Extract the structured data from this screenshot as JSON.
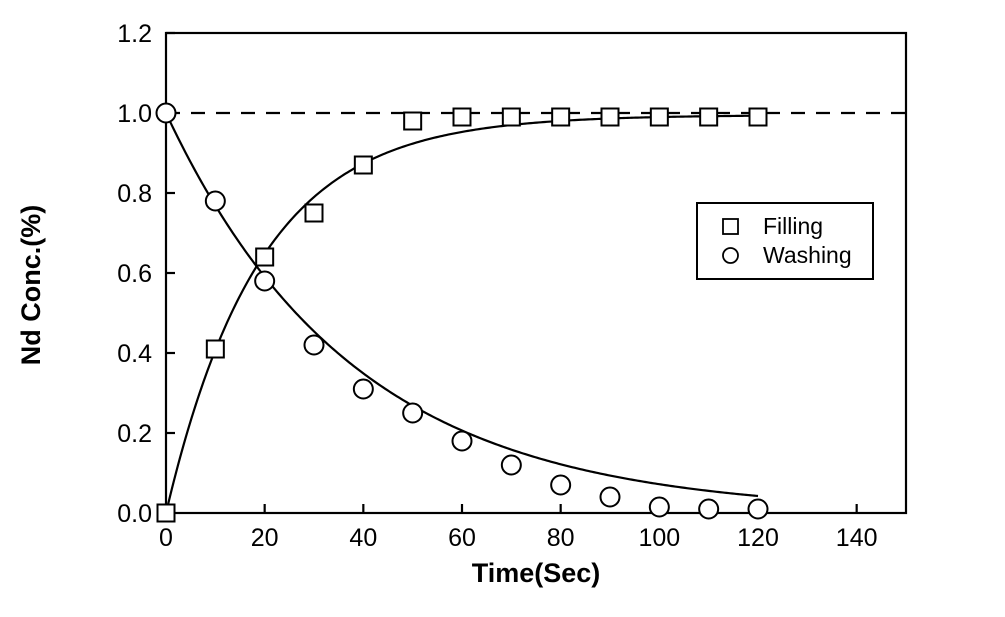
{
  "chart_data": {
    "type": "scatter",
    "title": "",
    "xlabel": "Time(Sec)",
    "ylabel": "Nd Conc.(%)",
    "xlim": [
      0,
      150
    ],
    "ylim": [
      0.0,
      1.2
    ],
    "xticks": [
      0,
      20,
      40,
      60,
      80,
      100,
      120,
      140
    ],
    "xtick_labels": [
      "0",
      "20",
      "40",
      "60",
      "80",
      "100",
      "120",
      "140"
    ],
    "yticks": [
      0.0,
      0.2,
      0.4,
      0.6,
      0.8,
      1.0,
      1.2
    ],
    "ytick_labels": [
      "0.0",
      "0.2",
      "0.4",
      "0.6",
      "0.8",
      "1.0",
      "1.2"
    ],
    "grid": false,
    "legend_position": "right-upper-inside",
    "annotations": [
      {
        "name": "asymptote-dashed-line",
        "kind": "horizontal-dashed-line",
        "y": 1.0,
        "x_start": 0,
        "x_end": 150
      }
    ],
    "series": [
      {
        "name": "Filling",
        "marker": "square",
        "marker_filled": false,
        "color": "#000000",
        "has_fit_curve": true,
        "fit_model": "1 - exp(-t/19)",
        "x": [
          0,
          10,
          20,
          30,
          40,
          50,
          60,
          70,
          80,
          90,
          100,
          110,
          120
        ],
        "y": [
          0.0,
          0.41,
          0.64,
          0.75,
          0.87,
          0.98,
          0.99,
          0.99,
          0.99,
          0.99,
          0.99,
          0.99,
          0.99
        ]
      },
      {
        "name": "Washing",
        "marker": "circle",
        "marker_filled": false,
        "color": "#000000",
        "has_fit_curve": true,
        "fit_model": "exp(-t/38)",
        "x": [
          0,
          10,
          20,
          30,
          40,
          50,
          60,
          70,
          80,
          90,
          100,
          110,
          120
        ],
        "y": [
          1.0,
          0.78,
          0.58,
          0.42,
          0.31,
          0.25,
          0.18,
          0.12,
          0.07,
          0.04,
          0.015,
          0.01,
          0.01
        ]
      }
    ],
    "legend": [
      {
        "label": "Filling",
        "marker": "square"
      },
      {
        "label": "Washing",
        "marker": "circle"
      }
    ]
  }
}
